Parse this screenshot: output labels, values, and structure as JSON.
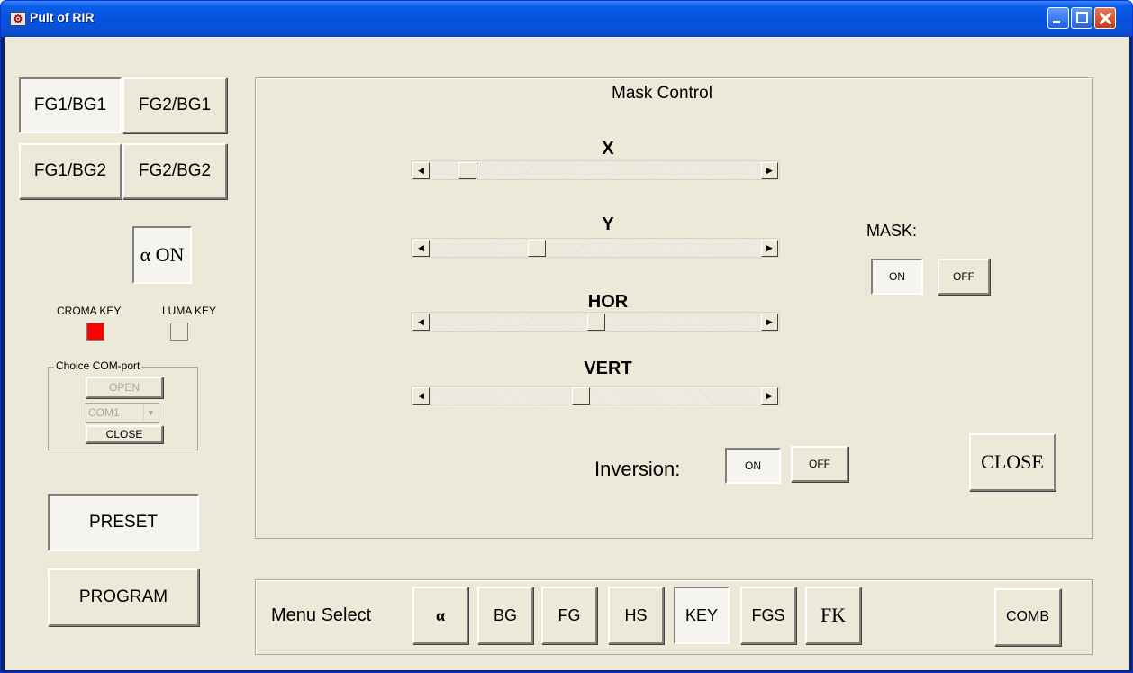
{
  "window": {
    "title": "Pult of RIR"
  },
  "source_buttons": {
    "fg1_bg1": "FG1/BG1",
    "fg2_bg1": "FG2/BG1",
    "fg1_bg2": "FG1/BG2",
    "fg2_bg2": "FG2/BG2"
  },
  "alpha_on": "α ON",
  "keys": {
    "croma_label": "CROMA KEY",
    "luma_label": "LUMA KEY",
    "croma_color": "#ff0000",
    "luma_color": "#ece9d8"
  },
  "com_port": {
    "group_title": "Choice COM-port",
    "open_label": "OPEN",
    "selected": "COM1",
    "close_label": "CLOSE"
  },
  "preset_label": "PRESET",
  "program_label": "PROGRAM",
  "mask_control": {
    "title": "Mask Control",
    "sliders": [
      {
        "label": "X",
        "value_fraction": 0.09
      },
      {
        "label": "Y",
        "value_fraction": 0.31
      },
      {
        "label": "HOR",
        "value_fraction": 0.5
      },
      {
        "label": "VERT",
        "value_fraction": 0.45
      }
    ],
    "mask_label": "MASK:",
    "mask_on": "ON",
    "mask_off": "OFF",
    "inversion_label": "Inversion:",
    "inversion_on": "ON",
    "inversion_off": "OFF",
    "close_label": "CLOSE"
  },
  "menu_select": {
    "label": "Menu Select",
    "items": [
      "α",
      "BG",
      "FG",
      "HS",
      "KEY",
      "FGS",
      "FK"
    ],
    "active_item": "KEY",
    "comb_label": "COMB"
  }
}
